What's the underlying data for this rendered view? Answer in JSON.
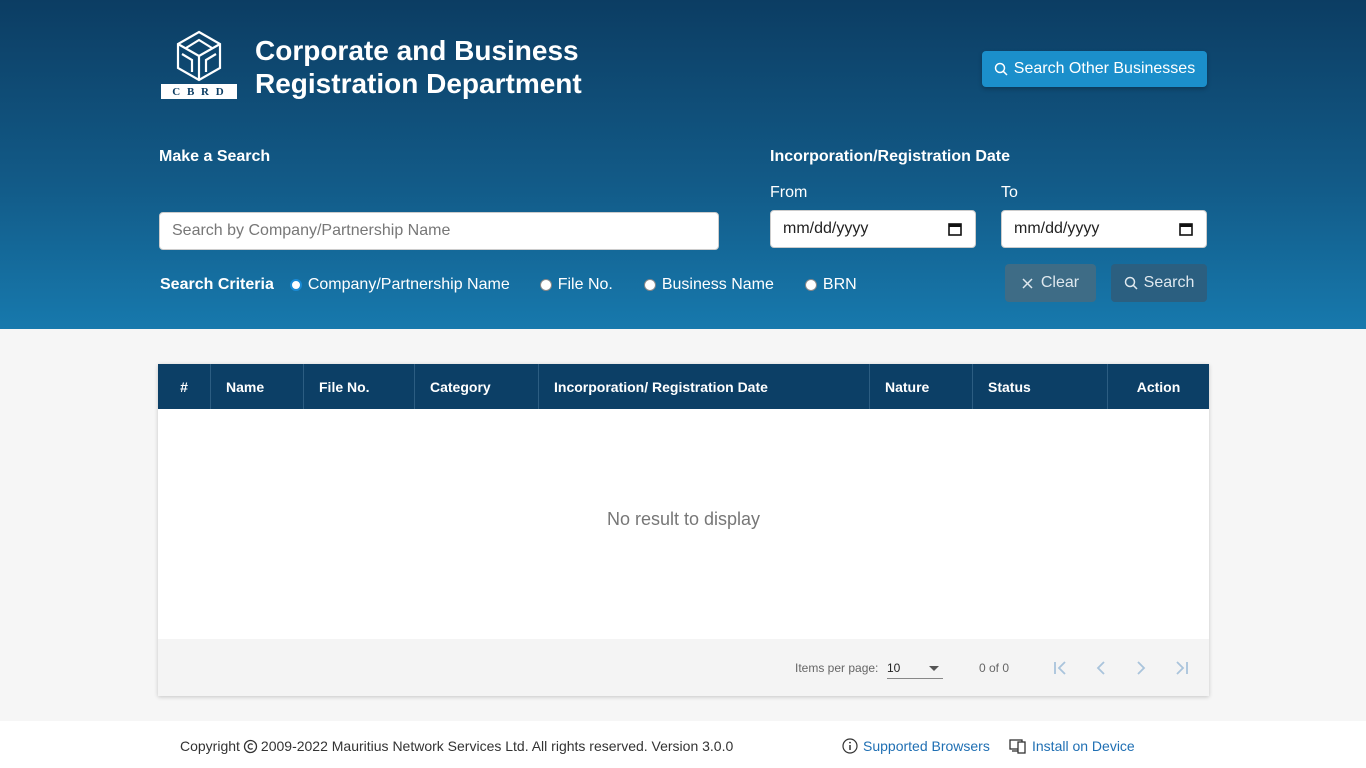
{
  "header": {
    "logo_text": "C B R D",
    "title_line1": "Corporate and Business",
    "title_line2": "Registration Department",
    "other_search_label": "Search Other Businesses",
    "other_search_icon": "search-icon"
  },
  "search": {
    "section_title": "Make a Search",
    "placeholder": "Search by Company/Partnership Name",
    "value": "",
    "criteria_label": "Search Criteria",
    "criteria_options": [
      {
        "label": "Company/Partnership Name",
        "selected": true
      },
      {
        "label": "File No.",
        "selected": false
      },
      {
        "label": "Business Name",
        "selected": false
      },
      {
        "label": "BRN",
        "selected": false
      }
    ]
  },
  "date_filter": {
    "section_title": "Incorporation/Registration Date",
    "from_label": "From",
    "to_label": "To",
    "from_value": "mm/dd/yyyy",
    "to_value": "mm/dd/yyyy",
    "calendar_icon": "calendar-icon"
  },
  "actions": {
    "clear_label": "Clear",
    "search_label": "Search"
  },
  "table": {
    "columns": [
      "#",
      "Name",
      "File No.",
      "Category",
      "Incorporation/ Registration Date",
      "Nature",
      "Status",
      "Action"
    ],
    "rows": [],
    "empty_message": "No result to display"
  },
  "paginator": {
    "items_per_page_label": "Items per page:",
    "items_per_page_value": "10",
    "range_label": "0 of 0"
  },
  "footer": {
    "copyright_prefix": "Copyright",
    "copyright_text": "2009-2022 Mauritius Network Services Ltd. All rights reserved. Version 3.0.0",
    "supported_browsers": "Supported Browsers",
    "install_on_device": "Install on Device"
  },
  "colors": {
    "header_dark": "#0c3d63",
    "header_light": "#1779ad",
    "accent_button": "#1b8fcb",
    "table_header": "#0c3f66",
    "link": "#1f6fb3"
  }
}
